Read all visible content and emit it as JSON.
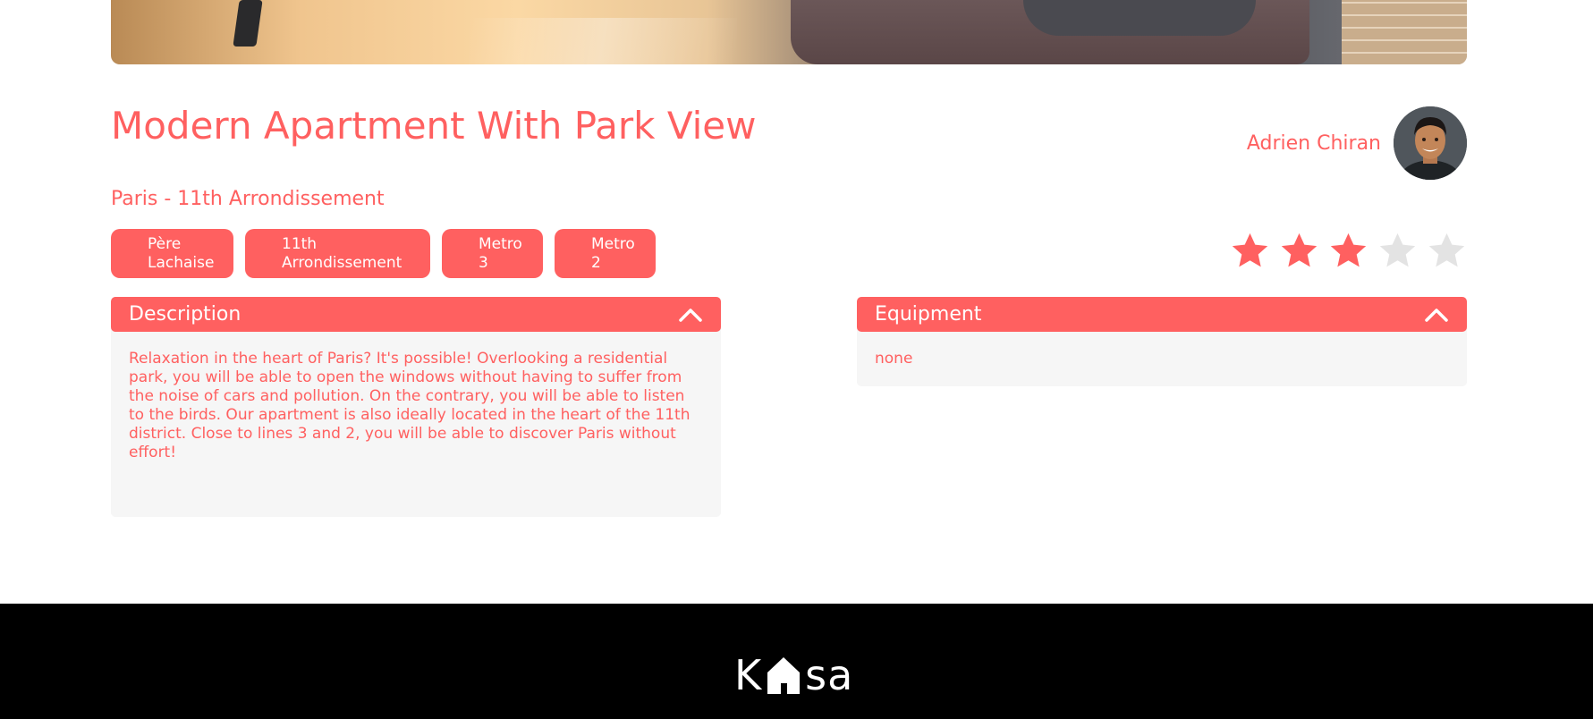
{
  "listing": {
    "title": "Modern Apartment With Park View",
    "location": "Paris - 11th Arrondissement",
    "tags": [
      "Père Lachaise",
      "11th Arrondissement",
      "Metro 3",
      "Metro 2"
    ],
    "rating": 3,
    "rating_max": 5
  },
  "host": {
    "name": "Adrien Chiran"
  },
  "description": {
    "title": "Description",
    "body": "Relaxation in the heart of Paris? It's possible! Overlooking a residential park, you will be able to open the windows without having to suffer from the noise of cars and pollution. On the contrary, you will be able to listen to the birds. Our apartment is also ideally located in the heart of the 11th district. Close to lines 3 and 2, you will be able to discover Paris without effort!"
  },
  "equipment": {
    "title": "Equipment",
    "body": "none"
  },
  "footer": {
    "logo_left": "K",
    "logo_right": "sa"
  },
  "colors": {
    "accent": "#FF6060",
    "star_empty": "#E3E3E3",
    "panel_bg": "#F6F6F6",
    "footer_bg": "#000000"
  },
  "icons": {
    "collapse": "chevron-up-icon",
    "star": "star-icon",
    "logo": "house-icon"
  }
}
